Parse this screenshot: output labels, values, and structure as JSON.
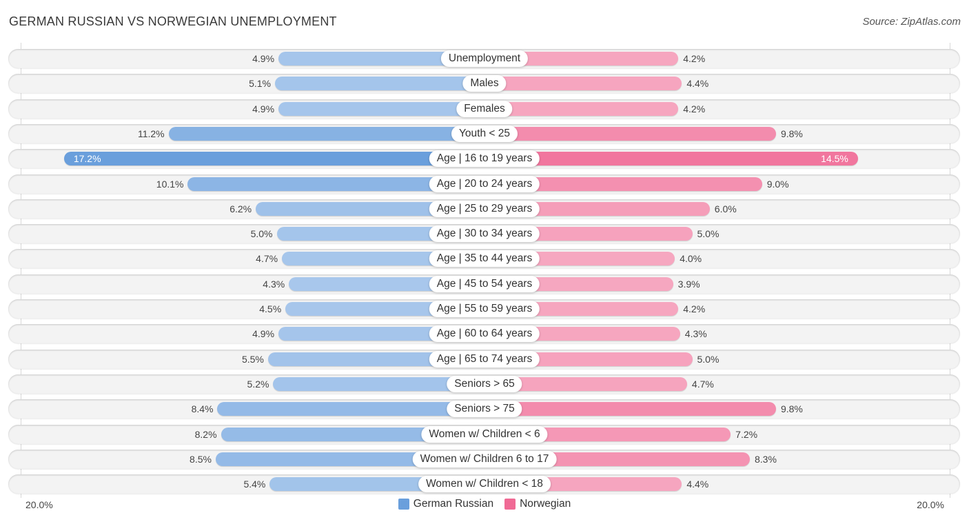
{
  "header": {
    "title": "GERMAN RUSSIAN VS NORWEGIAN UNEMPLOYMENT",
    "source": "Source: ZipAtlas.com"
  },
  "colors": {
    "german_russian": "#6a9fdc",
    "german_russian_light": "#a9c8ec",
    "norwegian": "#f06a95",
    "norwegian_light": "#f6a7c0"
  },
  "chart_data": {
    "type": "bar",
    "orientation": "horizontal-diverging",
    "title": "GERMAN RUSSIAN VS NORWEGIAN UNEMPLOYMENT",
    "xlim": [
      0,
      20
    ],
    "axis_labels": {
      "left": "20.0%",
      "right": "20.0%"
    },
    "legend": {
      "position": "bottom-center",
      "entries": [
        "German Russian",
        "Norwegian"
      ]
    },
    "categories": [
      "Unemployment",
      "Males",
      "Females",
      "Youth < 25",
      "Age | 16 to 19 years",
      "Age | 20 to 24 years",
      "Age | 25 to 29 years",
      "Age | 30 to 34 years",
      "Age | 35 to 44 years",
      "Age | 45 to 54 years",
      "Age | 55 to 59 years",
      "Age | 60 to 64 years",
      "Age | 65 to 74 years",
      "Seniors > 65",
      "Seniors > 75",
      "Women w/ Children < 6",
      "Women w/ Children 6 to 17",
      "Women w/ Children < 18"
    ],
    "series": [
      {
        "name": "German Russian",
        "side": "left",
        "values": [
          4.9,
          5.1,
          4.9,
          11.2,
          17.2,
          10.1,
          6.2,
          5.0,
          4.7,
          4.3,
          4.5,
          4.9,
          5.5,
          5.2,
          8.4,
          8.2,
          8.5,
          5.4
        ],
        "labels": [
          "4.9%",
          "5.1%",
          "4.9%",
          "11.2%",
          "17.2%",
          "10.1%",
          "6.2%",
          "5.0%",
          "4.7%",
          "4.3%",
          "4.5%",
          "4.9%",
          "5.5%",
          "5.2%",
          "8.4%",
          "8.2%",
          "8.5%",
          "5.4%"
        ]
      },
      {
        "name": "Norwegian",
        "side": "right",
        "values": [
          4.2,
          4.4,
          4.2,
          9.8,
          14.5,
          9.0,
          6.0,
          5.0,
          4.0,
          3.9,
          4.2,
          4.3,
          5.0,
          4.7,
          9.8,
          7.2,
          8.3,
          4.4
        ],
        "labels": [
          "4.2%",
          "4.4%",
          "4.2%",
          "9.8%",
          "14.5%",
          "9.0%",
          "6.0%",
          "5.0%",
          "4.0%",
          "3.9%",
          "4.2%",
          "4.3%",
          "5.0%",
          "4.7%",
          "9.8%",
          "7.2%",
          "8.3%",
          "4.4%"
        ]
      }
    ]
  }
}
